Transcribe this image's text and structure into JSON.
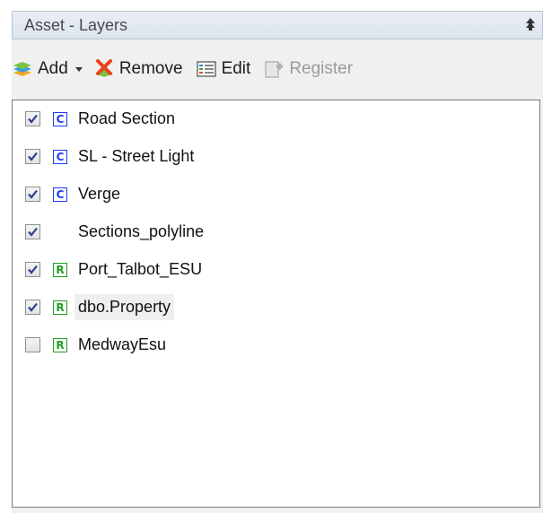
{
  "panel": {
    "title": "Asset - Layers",
    "pin_icon": "pin-up-icon"
  },
  "toolbar": {
    "add_label": "Add",
    "remove_label": "Remove",
    "edit_label": "Edit",
    "register_label": "Register"
  },
  "layers": [
    {
      "label": "Road Section",
      "checked": true,
      "badge": "C",
      "badge_color": "#1c3cf2"
    },
    {
      "label": "SL - Street Light",
      "checked": true,
      "badge": "C",
      "badge_color": "#1c3cf2"
    },
    {
      "label": "Verge",
      "checked": true,
      "badge": "C",
      "badge_color": "#1c3cf2"
    },
    {
      "label": "Sections_polyline",
      "checked": true,
      "badge": "",
      "badge_color": ""
    },
    {
      "label": "Port_Talbot_ESU",
      "checked": true,
      "badge": "R",
      "badge_color": "#1e9e1e"
    },
    {
      "label": "dbo.Property",
      "checked": true,
      "badge": "R",
      "badge_color": "#1e9e1e"
    },
    {
      "label": "MedwayEsu",
      "checked": false,
      "badge": "R",
      "badge_color": "#1e9e1e"
    }
  ]
}
